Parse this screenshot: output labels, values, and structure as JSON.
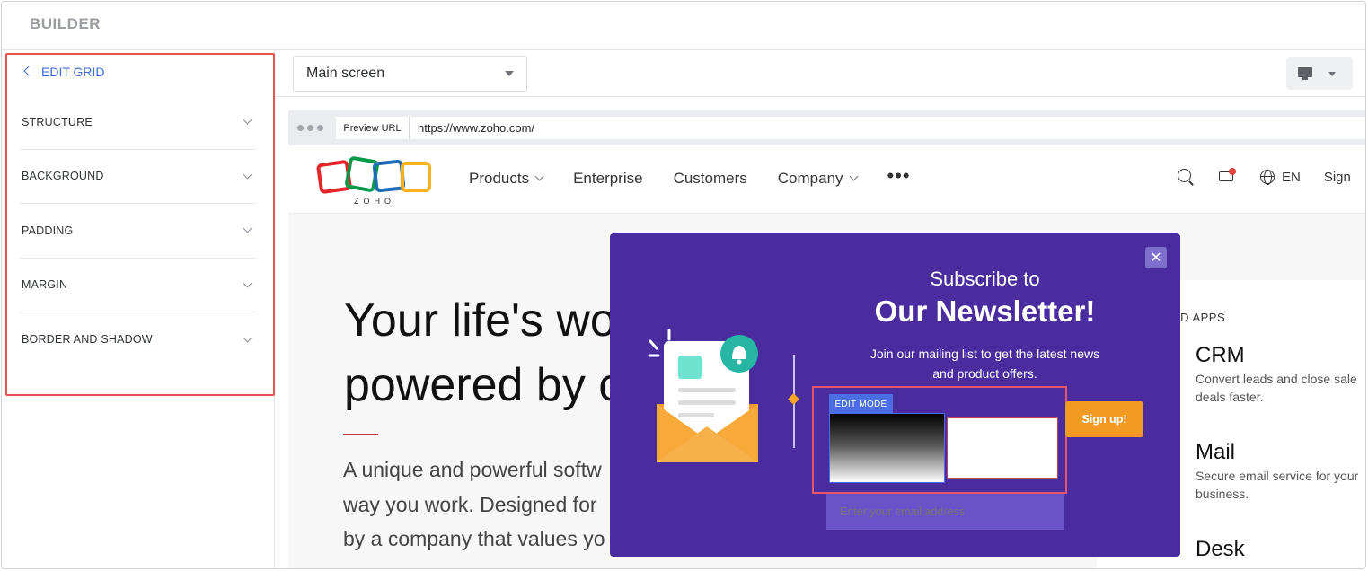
{
  "header": {
    "title": "BUILDER"
  },
  "left_panel": {
    "back_label": "EDIT GRID",
    "sections": [
      {
        "label": "STRUCTURE"
      },
      {
        "label": "BACKGROUND"
      },
      {
        "label": "PADDING"
      },
      {
        "label": "MARGIN"
      },
      {
        "label": "BORDER AND SHADOW"
      }
    ]
  },
  "toolbar": {
    "screen_select": "Main screen",
    "device_icon": "monitor-icon"
  },
  "preview": {
    "url_tag": "Preview URL",
    "url": "https://www.zoho.com/"
  },
  "site": {
    "logo_text": "ZOHO",
    "nav": [
      "Products",
      "Enterprise",
      "Customers",
      "Company"
    ],
    "nav_more": "•••",
    "lang": "EN",
    "signin": "Sign",
    "hero_line1": "Your life's wo",
    "hero_line2": "powered by c",
    "hero_sub": [
      "A unique and powerful softw",
      "way you work. Designed for",
      "by a company that values yo"
    ],
    "apps_title": "ED APPS",
    "apps": [
      {
        "name": "CRM",
        "desc": "Convert leads and close sale deals faster."
      },
      {
        "name": "Mail",
        "desc": "Secure email service for your business."
      },
      {
        "name": "Desk",
        "desc": ""
      }
    ]
  },
  "popup": {
    "title_small": "Subscribe to",
    "title_big": "Our Newsletter!",
    "description": "Join our mailing list to get the latest news and product offers.",
    "edit_mode_label": "EDIT MODE",
    "signup_label": "Sign up!",
    "email_placeholder": "Enter your email address",
    "close_icon": "close-icon"
  },
  "colors": {
    "accent": "#3f6ad8",
    "highlight": "#e6544b",
    "popup_bg": "#4a2c9f",
    "signup": "#f29a22"
  }
}
